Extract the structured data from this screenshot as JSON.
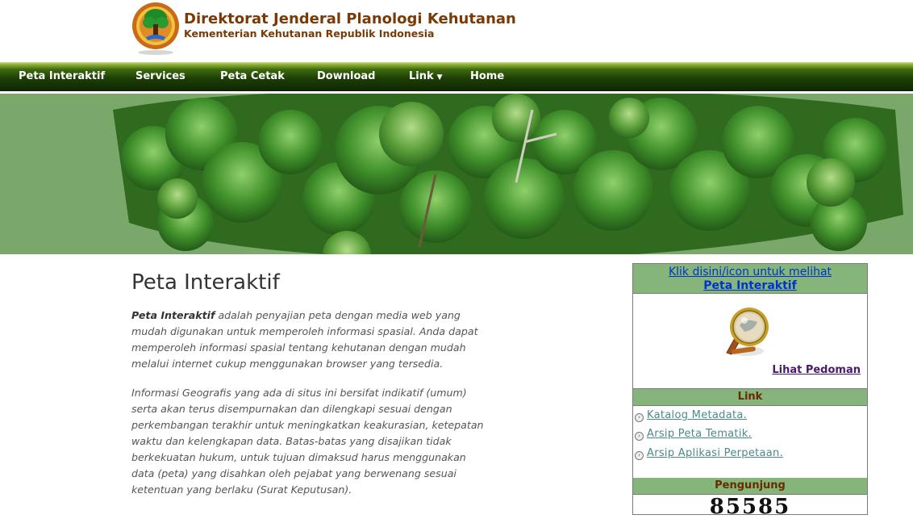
{
  "header": {
    "title": "Direktorat Jenderal Planologi Kehutanan",
    "subtitle": "Kementerian Kehutanan Republik Indonesia"
  },
  "nav": {
    "items": [
      {
        "label": "Peta Interaktif"
      },
      {
        "label": "Services"
      },
      {
        "label": "Peta Cetak"
      },
      {
        "label": "Download"
      },
      {
        "label": "Link",
        "has_dropdown": true
      },
      {
        "label": "Home"
      }
    ]
  },
  "main": {
    "title": "Peta Interaktif",
    "p1_lead": "Peta Interaktif",
    "p1_rest": " adalah penyajian peta dengan media web yang mudah digunakan untuk memperoleh informasi spasial. Anda dapat memperoleh informasi spasial tentang kehutanan dengan mudah melalui internet cukup menggunakan browser yang tersedia.",
    "p2": "Informasi Geografis yang ada di situs ini bersifat indikatif (umum) serta akan terus disempurnakan dan dilengkapi sesuai dengan perkembangan terakhir untuk meningkatkan keakurasian, ketepatan waktu dan kelengkapan data. Batas-batas yang disajikan tidak berkekuatan hukum, untuk tujuan dimaksud harus menggunakan data (peta) yang disahkan oleh pejabat yang berwenang sesuai ketentuan yang berlaku (Surat Keputusan)."
  },
  "sidebar": {
    "promo_line1": "Klik disini/icon untuk melihat",
    "promo_line2": "Peta Interaktif",
    "guide_link": "Lihat Pedoman",
    "link_heading": "Link",
    "links": [
      {
        "label": "Katalog Metadata."
      },
      {
        "label": "Arsip Peta Tematik."
      },
      {
        "label": "Arsip Aplikasi Perpetaan."
      }
    ],
    "visitor_heading": "Pengunjung",
    "visitor_count": "85585"
  },
  "colors": {
    "nav_dark": "#1d3f05",
    "sidebar_header": "#85b57a",
    "title_brown": "#7a3a05"
  }
}
